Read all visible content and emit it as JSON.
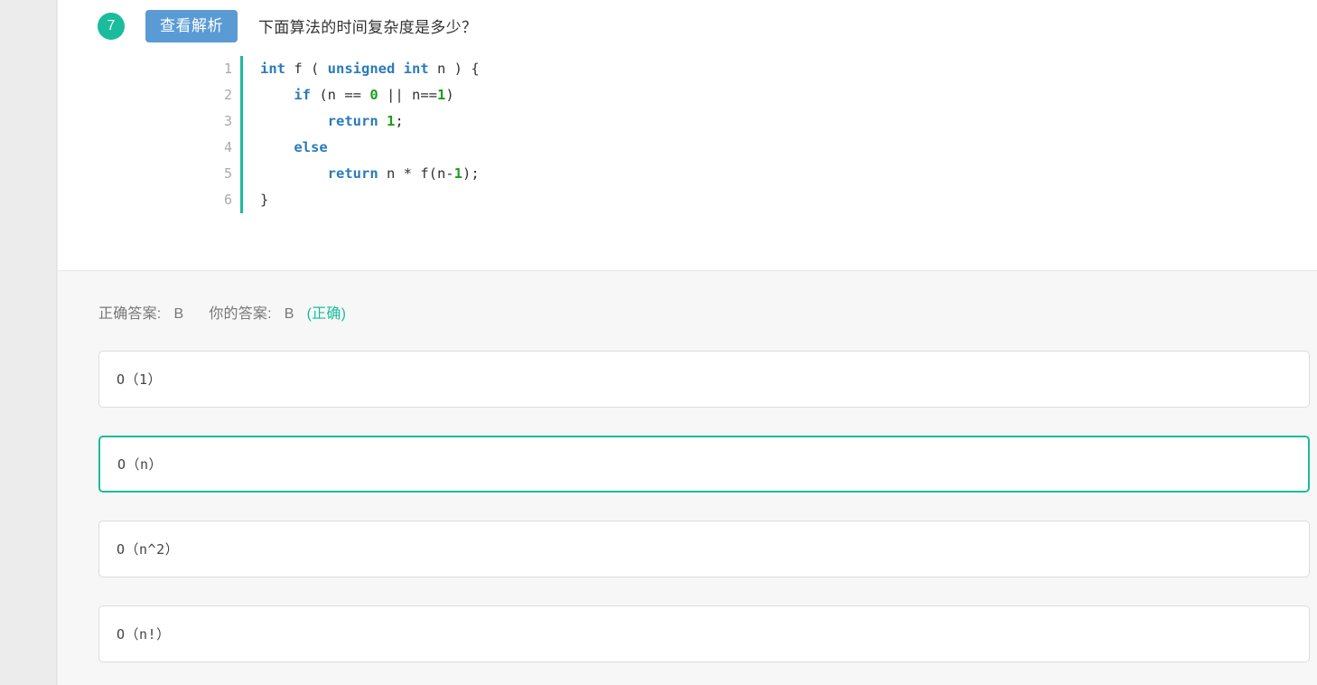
{
  "question": {
    "number": "7",
    "analysis_button_label": "查看解析",
    "title": "下面算法的时间复杂度是多少？",
    "code": {
      "language": "c",
      "lines": [
        {
          "no": "1",
          "text": "int f ( unsigned int n ) {"
        },
        {
          "no": "2",
          "text": "    if (n == 0 || n==1)"
        },
        {
          "no": "3",
          "text": "        return 1;"
        },
        {
          "no": "4",
          "text": "    else"
        },
        {
          "no": "5",
          "text": "        return n * f(n-1);"
        },
        {
          "no": "6",
          "text": "}"
        }
      ]
    }
  },
  "answer": {
    "correct_label": "正确答案:",
    "correct_value": "B",
    "your_label": "你的答案:",
    "your_value": "B",
    "result_text": "(正确)"
  },
  "options": [
    {
      "key": "A",
      "text": "O（1）",
      "selected": false
    },
    {
      "key": "B",
      "text": "O（n）",
      "selected": true
    },
    {
      "key": "C",
      "text": "O（n^2）",
      "selected": false
    },
    {
      "key": "D",
      "text": "O（n!）",
      "selected": false
    }
  ],
  "colors": {
    "accent_teal": "#1abc9c",
    "button_blue": "#5b9bd5",
    "text_dark": "#333333",
    "text_muted": "#777777",
    "code_keyword": "#2b7bb9",
    "code_number": "#1a9e1a",
    "panel_bg": "#ffffff",
    "answer_bg": "#f7f7f7",
    "page_bg": "#ececec"
  }
}
